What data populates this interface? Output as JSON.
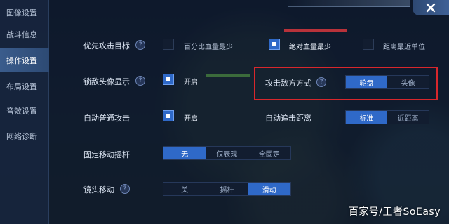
{
  "sidebar": {
    "items": [
      {
        "label": "图像设置",
        "active": false
      },
      {
        "label": "战斗信息",
        "active": false
      },
      {
        "label": "操作设置",
        "active": true
      },
      {
        "label": "布局设置",
        "active": false
      },
      {
        "label": "音效设置",
        "active": false
      },
      {
        "label": "网络诊断",
        "active": false
      }
    ]
  },
  "settings": {
    "target_priority": {
      "label": "优先攻击目标",
      "options": [
        {
          "label": "百分比血量最少",
          "checked": false
        },
        {
          "label": "绝对血量最少",
          "checked": true
        },
        {
          "label": "距离最近单位",
          "checked": false
        }
      ]
    },
    "lock_avatar": {
      "label": "锁敌头像显示",
      "option_label": "开启",
      "checked": true
    },
    "attack_method": {
      "label": "攻击敌方方式",
      "options": [
        "轮盘",
        "头像"
      ],
      "selected": "轮盘"
    },
    "auto_attack": {
      "label": "自动普通攻击",
      "option_label": "开启",
      "checked": true
    },
    "auto_chase": {
      "label": "自动追击距离",
      "options": [
        "标准",
        "近距离"
      ],
      "selected": "标准"
    },
    "fixed_joystick": {
      "label": "固定移动摇杆",
      "options": [
        "无",
        "仅表现",
        "全固定"
      ],
      "selected": "无"
    },
    "camera_move": {
      "label": "镜头移动",
      "options": [
        "关",
        "摇杆",
        "滑动"
      ],
      "selected": "滑动"
    }
  },
  "icons": {
    "close": "close-icon",
    "help": "help-icon"
  },
  "colors": {
    "accent": "#2f69c8",
    "highlight_box": "#d8272c"
  },
  "watermark": "百家号/王者SoEasy"
}
